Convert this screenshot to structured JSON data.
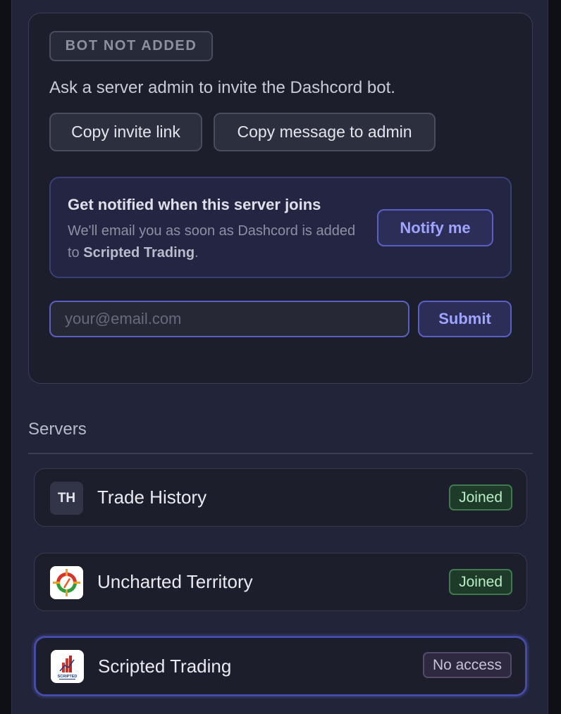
{
  "bot_card": {
    "status_badge": "BOT NOT ADDED",
    "instruction": "Ask a server admin to invite the Dashcord bot.",
    "copy_invite_label": "Copy invite link",
    "copy_message_label": "Copy message to admin",
    "notify": {
      "title": "Get notified when this server joins",
      "desc_prefix": "We'll email you as soon as Dashcord is added to ",
      "desc_server": "Scripted Trading",
      "desc_suffix": ".",
      "button_label": "Notify me"
    },
    "email": {
      "placeholder": "your@email.com",
      "value": "",
      "submit_label": "Submit"
    }
  },
  "servers": {
    "title": "Servers",
    "items": [
      {
        "initials": "TH",
        "icon": "initials-avatar",
        "name": "Trade History",
        "status": "Joined"
      },
      {
        "initials": "",
        "icon": "uncharted-territory-logo",
        "name": "Uncharted Territory",
        "status": "Joined"
      },
      {
        "initials": "",
        "icon": "scripted-trading-logo",
        "logo_text": "SCRIPTED",
        "name": "Scripted Trading",
        "status": "No access",
        "selected": true
      }
    ]
  },
  "colors": {
    "accent": "#5a5fc4",
    "joined": "#3e7a4d",
    "no_access": "#554a6c"
  }
}
